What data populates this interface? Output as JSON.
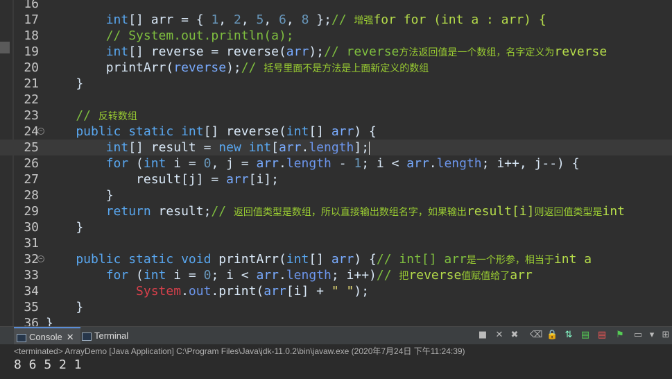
{
  "editor": {
    "lines": [
      {
        "num": "16",
        "segs": []
      },
      {
        "num": "17",
        "segs": [
          [
            "k",
            "        int"
          ],
          [
            "fn",
            "[] arr = { "
          ],
          [
            "num",
            "1"
          ],
          [
            "fn",
            ", "
          ],
          [
            "num",
            "2"
          ],
          [
            "fn",
            ", "
          ],
          [
            "num",
            "5"
          ],
          [
            "fn",
            ", "
          ],
          [
            "num",
            "6"
          ],
          [
            "fn",
            ", "
          ],
          [
            "num",
            "8"
          ],
          [
            "fn",
            " };"
          ],
          [
            "cm",
            "// "
          ],
          [
            "cmz",
            "增强"
          ],
          [
            "cmb",
            "for for (int a : arr) {"
          ]
        ]
      },
      {
        "num": "18",
        "segs": [
          [
            "cm",
            "        // System.out.println(a);"
          ]
        ]
      },
      {
        "num": "19",
        "segs": [
          [
            "k",
            "        int"
          ],
          [
            "fn",
            "[] reverse = reverse("
          ],
          [
            "var",
            "arr"
          ],
          [
            "fn",
            ");"
          ],
          [
            "cm",
            "// reverse"
          ],
          [
            "cmz",
            "方法返回值是一个数组，名字定义为"
          ],
          [
            "cmb",
            "reverse"
          ]
        ]
      },
      {
        "num": "20",
        "segs": [
          [
            "fn",
            "        printArr("
          ],
          [
            "var",
            "reverse"
          ],
          [
            "fn",
            ");"
          ],
          [
            "cm",
            "// "
          ],
          [
            "cmz",
            "括号里面不是方法是上面新定义的数组"
          ]
        ]
      },
      {
        "num": "21",
        "segs": [
          [
            "fn",
            "    }"
          ]
        ]
      },
      {
        "num": "22",
        "segs": []
      },
      {
        "num": "23",
        "segs": [
          [
            "cm",
            "    // "
          ],
          [
            "cmz",
            "反转数组"
          ]
        ]
      },
      {
        "num": "24",
        "fold": true,
        "segs": [
          [
            "k",
            "    public static int"
          ],
          [
            "fn",
            "[] reverse("
          ],
          [
            "k",
            "int"
          ],
          [
            "fn",
            "[] "
          ],
          [
            "var",
            "arr"
          ],
          [
            "fn",
            ") {"
          ]
        ]
      },
      {
        "num": "25",
        "current": true,
        "segs": [
          [
            "k",
            "        int"
          ],
          [
            "fn",
            "[] result = "
          ],
          [
            "k",
            "new int"
          ],
          [
            "fn",
            "["
          ],
          [
            "var",
            "arr"
          ],
          [
            "fn",
            "."
          ],
          [
            "fld",
            "length"
          ],
          [
            "fn",
            "];"
          ]
        ],
        "caret": true
      },
      {
        "num": "26",
        "segs": [
          [
            "k",
            "        for"
          ],
          [
            "fn",
            " ("
          ],
          [
            "k",
            "int"
          ],
          [
            "fn",
            " i = "
          ],
          [
            "num",
            "0"
          ],
          [
            "fn",
            ", j = "
          ],
          [
            "var",
            "arr"
          ],
          [
            "fn",
            "."
          ],
          [
            "fld",
            "length"
          ],
          [
            "fn",
            " - "
          ],
          [
            "num",
            "1"
          ],
          [
            "fn",
            "; i < "
          ],
          [
            "var",
            "arr"
          ],
          [
            "fn",
            "."
          ],
          [
            "fld",
            "length"
          ],
          [
            "fn",
            "; i++, j--) {"
          ]
        ]
      },
      {
        "num": "27",
        "segs": [
          [
            "fn",
            "            result[j] = "
          ],
          [
            "var",
            "arr"
          ],
          [
            "fn",
            "[i];"
          ]
        ]
      },
      {
        "num": "28",
        "segs": [
          [
            "fn",
            "        }"
          ]
        ]
      },
      {
        "num": "29",
        "segs": [
          [
            "k",
            "        return"
          ],
          [
            "fn",
            " result;"
          ],
          [
            "cm",
            "// "
          ],
          [
            "cmz",
            "返回值类型是数组，所以直接输出数组名字，如果输出"
          ],
          [
            "cmb",
            "result[i]"
          ],
          [
            "cmz",
            "则返回值类型是"
          ],
          [
            "cmb",
            "int"
          ]
        ]
      },
      {
        "num": "30",
        "segs": [
          [
            "fn",
            "    }"
          ]
        ]
      },
      {
        "num": "31",
        "segs": []
      },
      {
        "num": "32",
        "fold": true,
        "segs": [
          [
            "k",
            "    public static void"
          ],
          [
            "fn",
            " printArr("
          ],
          [
            "k",
            "int"
          ],
          [
            "fn",
            "[] "
          ],
          [
            "var",
            "arr"
          ],
          [
            "fn",
            ") {"
          ],
          [
            "cm",
            "// int[] arr"
          ],
          [
            "cmz",
            "是一个形参，相当于"
          ],
          [
            "cmb",
            "int a"
          ]
        ]
      },
      {
        "num": "33",
        "segs": [
          [
            "k",
            "        for"
          ],
          [
            "fn",
            " ("
          ],
          [
            "k",
            "int"
          ],
          [
            "fn",
            " i = "
          ],
          [
            "num",
            "0"
          ],
          [
            "fn",
            "; i < "
          ],
          [
            "var",
            "arr"
          ],
          [
            "fn",
            "."
          ],
          [
            "fld",
            "length"
          ],
          [
            "fn",
            "; i++)"
          ],
          [
            "cm",
            "// "
          ],
          [
            "cmz",
            "把"
          ],
          [
            "cmb",
            "reverse"
          ],
          [
            "cmz",
            "值赋值给了"
          ],
          [
            "cmb",
            "arr"
          ]
        ]
      },
      {
        "num": "34",
        "segs": [
          [
            "sys",
            "            System"
          ],
          [
            "fn",
            "."
          ],
          [
            "fld",
            "out"
          ],
          [
            "fn",
            ".print("
          ],
          [
            "var",
            "arr"
          ],
          [
            "fn",
            "[i] + "
          ],
          [
            "str",
            "\" \""
          ],
          [
            "fn",
            ");"
          ]
        ]
      },
      {
        "num": "35",
        "segs": [
          [
            "fn",
            "    }"
          ]
        ]
      },
      {
        "num": "36",
        "segs": [
          [
            "fn",
            "}"
          ]
        ]
      }
    ]
  },
  "console": {
    "tab_console": "Console",
    "tab_terminal": "Terminal",
    "info": "<terminated> ArrayDemo [Java Application] C:\\Program Files\\Java\\jdk-11.0.2\\bin\\javaw.exe (2020年7月24日 下午11:24:39)",
    "output": "8 6 5 2 1"
  }
}
